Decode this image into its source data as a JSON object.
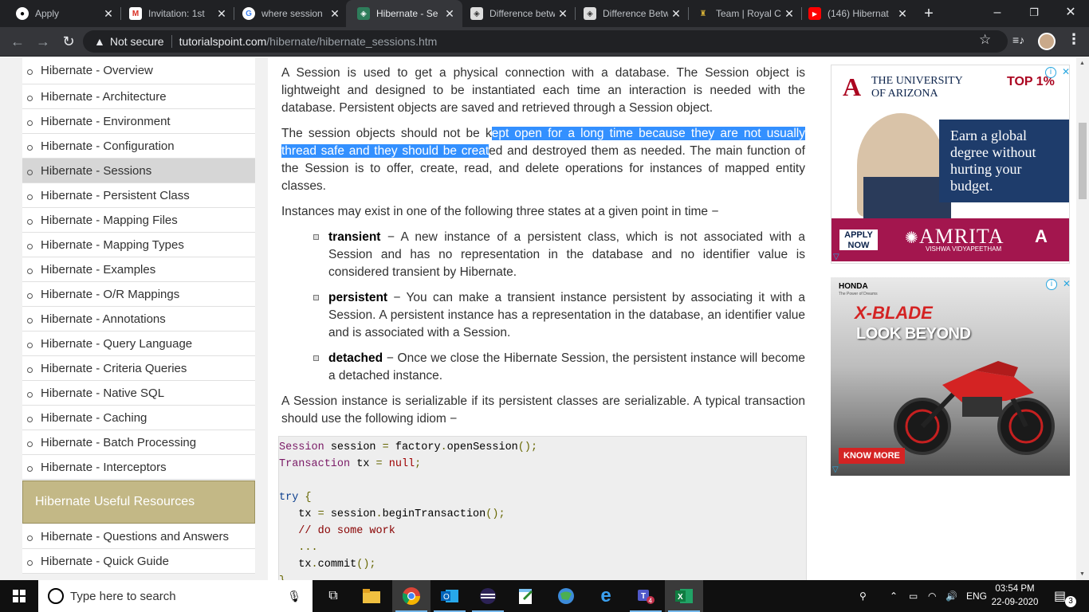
{
  "browser": {
    "tabs": [
      {
        "title": "Apply",
        "favicon": "github-icon"
      },
      {
        "title": "Invitation: 1st",
        "favicon": "gmail-icon"
      },
      {
        "title": "where session",
        "favicon": "google-icon"
      },
      {
        "title": "Hibernate - Se",
        "favicon": "tutorialspoint-icon",
        "active": true
      },
      {
        "title": "Difference betw",
        "favicon": "diamond-icon"
      },
      {
        "title": "Difference Betw",
        "favicon": "diamond-icon"
      },
      {
        "title": "Team | Royal C",
        "favicon": "crest-icon"
      },
      {
        "title": "(146) Hibernat",
        "favicon": "youtube-icon"
      }
    ],
    "new_tab": "+",
    "window_controls": {
      "minimize": "–",
      "maximize": "❐",
      "close": "✕"
    },
    "address": {
      "security": "Not secure",
      "host": "tutorialspoint.com",
      "path": "/hibernate/hibernate_sessions.htm"
    }
  },
  "sidebar": {
    "items": [
      {
        "label": "Hibernate - Overview"
      },
      {
        "label": "Hibernate - Architecture"
      },
      {
        "label": "Hibernate - Environment"
      },
      {
        "label": "Hibernate - Configuration"
      },
      {
        "label": "Hibernate - Sessions",
        "active": true
      },
      {
        "label": "Hibernate - Persistent Class"
      },
      {
        "label": "Hibernate - Mapping Files"
      },
      {
        "label": "Hibernate - Mapping Types"
      },
      {
        "label": "Hibernate - Examples"
      },
      {
        "label": "Hibernate - O/R Mappings"
      },
      {
        "label": "Hibernate - Annotations"
      },
      {
        "label": "Hibernate - Query Language"
      },
      {
        "label": "Hibernate - Criteria Queries"
      },
      {
        "label": "Hibernate - Native SQL"
      },
      {
        "label": "Hibernate - Caching"
      },
      {
        "label": "Hibernate - Batch Processing"
      },
      {
        "label": "Hibernate - Interceptors"
      }
    ],
    "resources_heading": "Hibernate Useful Resources",
    "resource_items": [
      {
        "label": "Hibernate - Questions and Answers"
      },
      {
        "label": "Hibernate - Quick Guide"
      }
    ]
  },
  "content": {
    "p1": "A Session is used to get a physical connection with a database. The Session object is lightweight and designed to be instantiated each time an interaction is needed with the database. Persistent objects are saved and retrieved through a Session object.",
    "p2_before": "The session objects should not be k",
    "p2_selected": "ept open for a long time because they are not usually thread safe and they should be creat",
    "p2_after": "ed and destroyed them as needed. The main function of the Session is to offer, create, read, and delete operations for instances of mapped entity classes.",
    "p3": "Instances may exist in one of the following three states at a given point in time −",
    "states": [
      {
        "term": "transient",
        "desc": " − A new instance of a persistent class, which is not associated with a Session and has no representation in the database and no identifier value is considered transient by Hibernate."
      },
      {
        "term": "persistent",
        "desc": " − You can make a transient instance persistent by associating it with a Session. A persistent instance has a representation in the database, an identifier value and is associated with a Session."
      },
      {
        "term": "detached",
        "desc": " − Once we close the Hibernate Session, the persistent instance will become a detached instance."
      }
    ],
    "p4": "A Session instance is serializable if its persistent classes are serializable. A typical transaction should use the following idiom −",
    "code": {
      "l1a": "Session",
      "l1b": " session ",
      "l1c": "=",
      "l1d": " factory",
      "l1e": ".",
      "l1f": "openSession",
      "l1g": "();",
      "l2a": "Transaction",
      "l2b": " tx ",
      "l2c": "=",
      "l2d": " null",
      "l2e": ";",
      "l4a": "try",
      "l4b": " {",
      "l5a": "   tx ",
      "l5b": "=",
      "l5c": " session",
      "l5d": ".",
      "l5e": "beginTransaction",
      "l5f": "();",
      "l6": "   // do some work",
      "l7": "   ...",
      "l8a": "   tx",
      "l8b": ".",
      "l8c": "commit",
      "l8d": "();",
      "l9": "}"
    }
  },
  "ads": {
    "ad1": {
      "university": "THE UNIVERSITY\nOF ARIZONA",
      "university_line1": "THE UNIVERSITY",
      "university_line2": "OF ARIZONA",
      "badge": "TOP 1%",
      "headline_1": "Earn a global",
      "headline_2": "degree without",
      "headline_3": "hurting your",
      "headline_4": "budget.",
      "cta_1": "APPLY",
      "cta_2": "NOW",
      "brand": "AMRITA",
      "brand_sub": "VISHWA VIDYAPEETHAM"
    },
    "ad2": {
      "brand": "HONDA",
      "brand_sub": "The Power of Dreams",
      "model": "X-BLADE",
      "headline": "LOOK BEYOND",
      "cta": "KNOW MORE"
    }
  },
  "taskbar": {
    "search_placeholder": "Type here to search",
    "language": "ENG",
    "time": "03:54 PM",
    "date": "22-09-2020",
    "notification_count": "3"
  }
}
